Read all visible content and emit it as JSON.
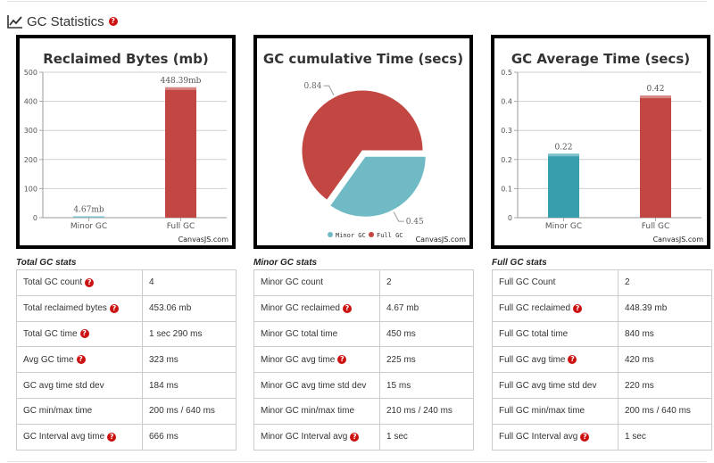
{
  "header": {
    "title": "GC Statistics",
    "icon": "line-chart-icon",
    "help_icon": "question-circle-icon"
  },
  "credit": "CanvasJS.com",
  "colors": {
    "teal": "#369ead",
    "red": "#c24642",
    "pie_teal": "#6fbac4",
    "pie_red": "#c24642",
    "help": "#cc1111"
  },
  "chart_data": [
    {
      "type": "bar",
      "title": "Reclaimed Bytes (mb)",
      "categories": [
        "Minor GC",
        "Full GC"
      ],
      "values": [
        4.67,
        448.39
      ],
      "value_labels": [
        "4.67mb",
        "448.39mb"
      ],
      "ylim": [
        0,
        500
      ],
      "yticks": [
        "0",
        "100",
        "200",
        "300",
        "400",
        "500"
      ],
      "grid": true
    },
    {
      "type": "pie",
      "title": "GC cumulative Time (secs)",
      "labels": [
        "Minor GC",
        "Full GC"
      ],
      "values": [
        0.45,
        0.84
      ],
      "value_labels": [
        "0.45",
        "0.84"
      ],
      "legend": "bottom"
    },
    {
      "type": "bar",
      "title": "GC Average Time (secs)",
      "categories": [
        "Minor GC",
        "Full GC"
      ],
      "values": [
        0.22,
        0.42
      ],
      "value_labels": [
        "0.22",
        "0.42"
      ],
      "ylim": [
        0,
        0.5
      ],
      "yticks": [
        "0",
        "0.1",
        "0.2",
        "0.3",
        "0.4",
        "0.5"
      ],
      "grid": true
    }
  ],
  "tables": {
    "total": {
      "title": "Total GC stats",
      "rows": [
        {
          "label": "Total GC count",
          "value": "4",
          "help": true
        },
        {
          "label": "Total reclaimed bytes",
          "value": "453.06 mb",
          "help": true
        },
        {
          "label": "Total GC time",
          "value": "1 sec 290 ms",
          "help": true
        },
        {
          "label": "Avg GC time",
          "value": "323 ms",
          "help": true
        },
        {
          "label": "GC avg time std dev",
          "value": "184 ms",
          "help": false
        },
        {
          "label": "GC min/max time",
          "value": "200 ms / 640 ms",
          "help": false
        },
        {
          "label": "GC Interval avg time",
          "value": "666 ms",
          "help": true
        }
      ]
    },
    "minor": {
      "title": "Minor GC stats",
      "rows": [
        {
          "label": "Minor GC count",
          "value": "2",
          "help": false
        },
        {
          "label": "Minor GC reclaimed",
          "value": "4.67 mb",
          "help": true
        },
        {
          "label": "Minor GC total time",
          "value": "450 ms",
          "help": false
        },
        {
          "label": "Minor GC avg time",
          "value": "225 ms",
          "help": true
        },
        {
          "label": "Minor GC avg time std dev",
          "value": "15 ms",
          "help": false
        },
        {
          "label": "Minor GC min/max time",
          "value": "210 ms / 240 ms",
          "help": false
        },
        {
          "label": "Minor GC Interval avg",
          "value": "1 sec",
          "help": true
        }
      ]
    },
    "full": {
      "title": "Full GC stats",
      "rows": [
        {
          "label": "Full GC Count",
          "value": "2",
          "help": false
        },
        {
          "label": "Full GC reclaimed",
          "value": "448.39 mb",
          "help": true
        },
        {
          "label": "Full GC total time",
          "value": "840 ms",
          "help": false
        },
        {
          "label": "Full GC avg time",
          "value": "420 ms",
          "help": true
        },
        {
          "label": "Full GC avg time std dev",
          "value": "220 ms",
          "help": false
        },
        {
          "label": "Full GC min/max time",
          "value": "200 ms / 640 ms",
          "help": false
        },
        {
          "label": "Full GC Interval avg",
          "value": "1 sec",
          "help": true
        }
      ]
    }
  }
}
